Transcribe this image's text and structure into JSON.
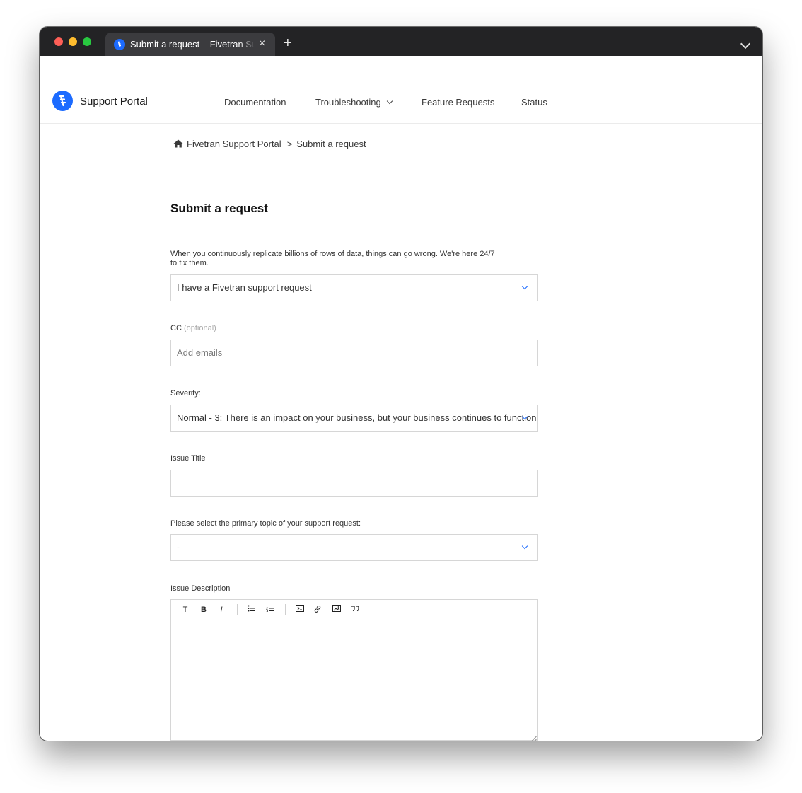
{
  "browser": {
    "tab_title": "Submit a request – Fivetran Support Portal",
    "tab_close": "×",
    "new_tab": "+"
  },
  "header": {
    "logo_text": "Support Portal",
    "nav": [
      {
        "label": "Documentation"
      },
      {
        "label": "Troubleshooting"
      },
      {
        "label": "Feature Requests"
      },
      {
        "label": "Status"
      }
    ]
  },
  "breadcrumb": {
    "home_label": "Fivetran Support Portal",
    "separator": ">",
    "current": "Submit a request"
  },
  "form": {
    "title": "Submit a request",
    "intro_line1": "When you continuously replicate billions of rows of data, things can go wrong. We're here 24/7",
    "intro_line2": "to fix them.",
    "request_type_value": "I have a Fivetran support request",
    "cc_label": "CC",
    "cc_optional": "(optional)",
    "cc_placeholder": "Add emails",
    "severity_label": "Severity:",
    "severity_value": "Normal - 3: There is an impact on your business, but your business continues to function",
    "issue_title_label": "Issue Title",
    "issue_title_value": "",
    "topic_label": "Please select the primary topic of your support request:",
    "topic_value": "-",
    "description_label": "Issue Description",
    "toolbar": [
      "text-style",
      "bold",
      "italic",
      "bulleted-list",
      "numbered-list",
      "code-block",
      "link",
      "image",
      "blockquote"
    ],
    "toolbar_glyphs": {
      "text": "T",
      "bold": "B",
      "italic": "I"
    }
  },
  "colors": {
    "accent": "#1c6bff",
    "titlebar": "#232325",
    "tab": "#3b3b3e"
  }
}
